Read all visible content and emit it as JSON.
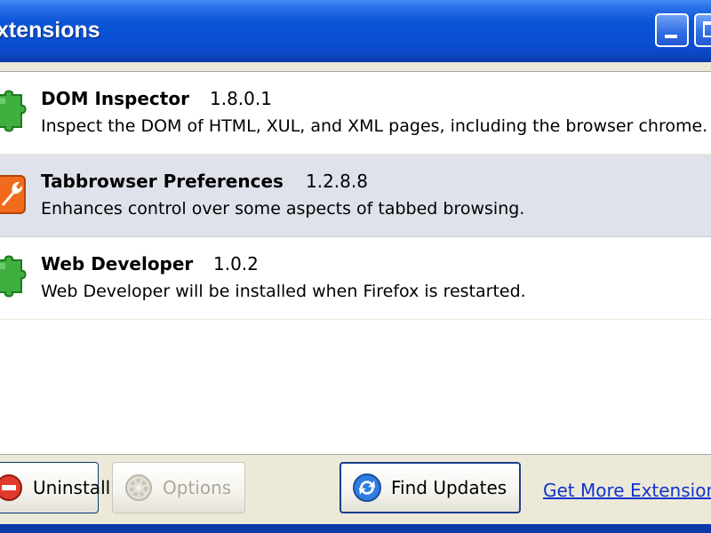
{
  "window": {
    "title": "xtensions"
  },
  "extensions": [
    {
      "name": "DOM Inspector",
      "version": "1.8.0.1",
      "description": "Inspect the DOM of HTML, XUL, and XML pages, including the browser chrome.",
      "icon": "puzzle-piece-icon",
      "selected": false
    },
    {
      "name": "Tabbrowser Preferences",
      "version": "1.2.8.8",
      "description": "Enhances control over some aspects of tabbed browsing.",
      "icon": "wrench-icon",
      "selected": true
    },
    {
      "name": "Web Developer",
      "version": "1.0.2",
      "description": "Web Developer will be installed when Firefox is restarted.",
      "icon": "puzzle-piece-icon",
      "selected": false
    }
  ],
  "buttons": {
    "uninstall": "Uninstall",
    "options": "Options",
    "find_updates": "Find Updates"
  },
  "links": {
    "get_more": "Get More Extensions"
  },
  "colors": {
    "titlebar": "#0b55d8",
    "selection": "#dfe2ea",
    "link": "#1133cc",
    "puzzle_green": "#3fb03f",
    "wrench_orange": "#f26a1c"
  }
}
